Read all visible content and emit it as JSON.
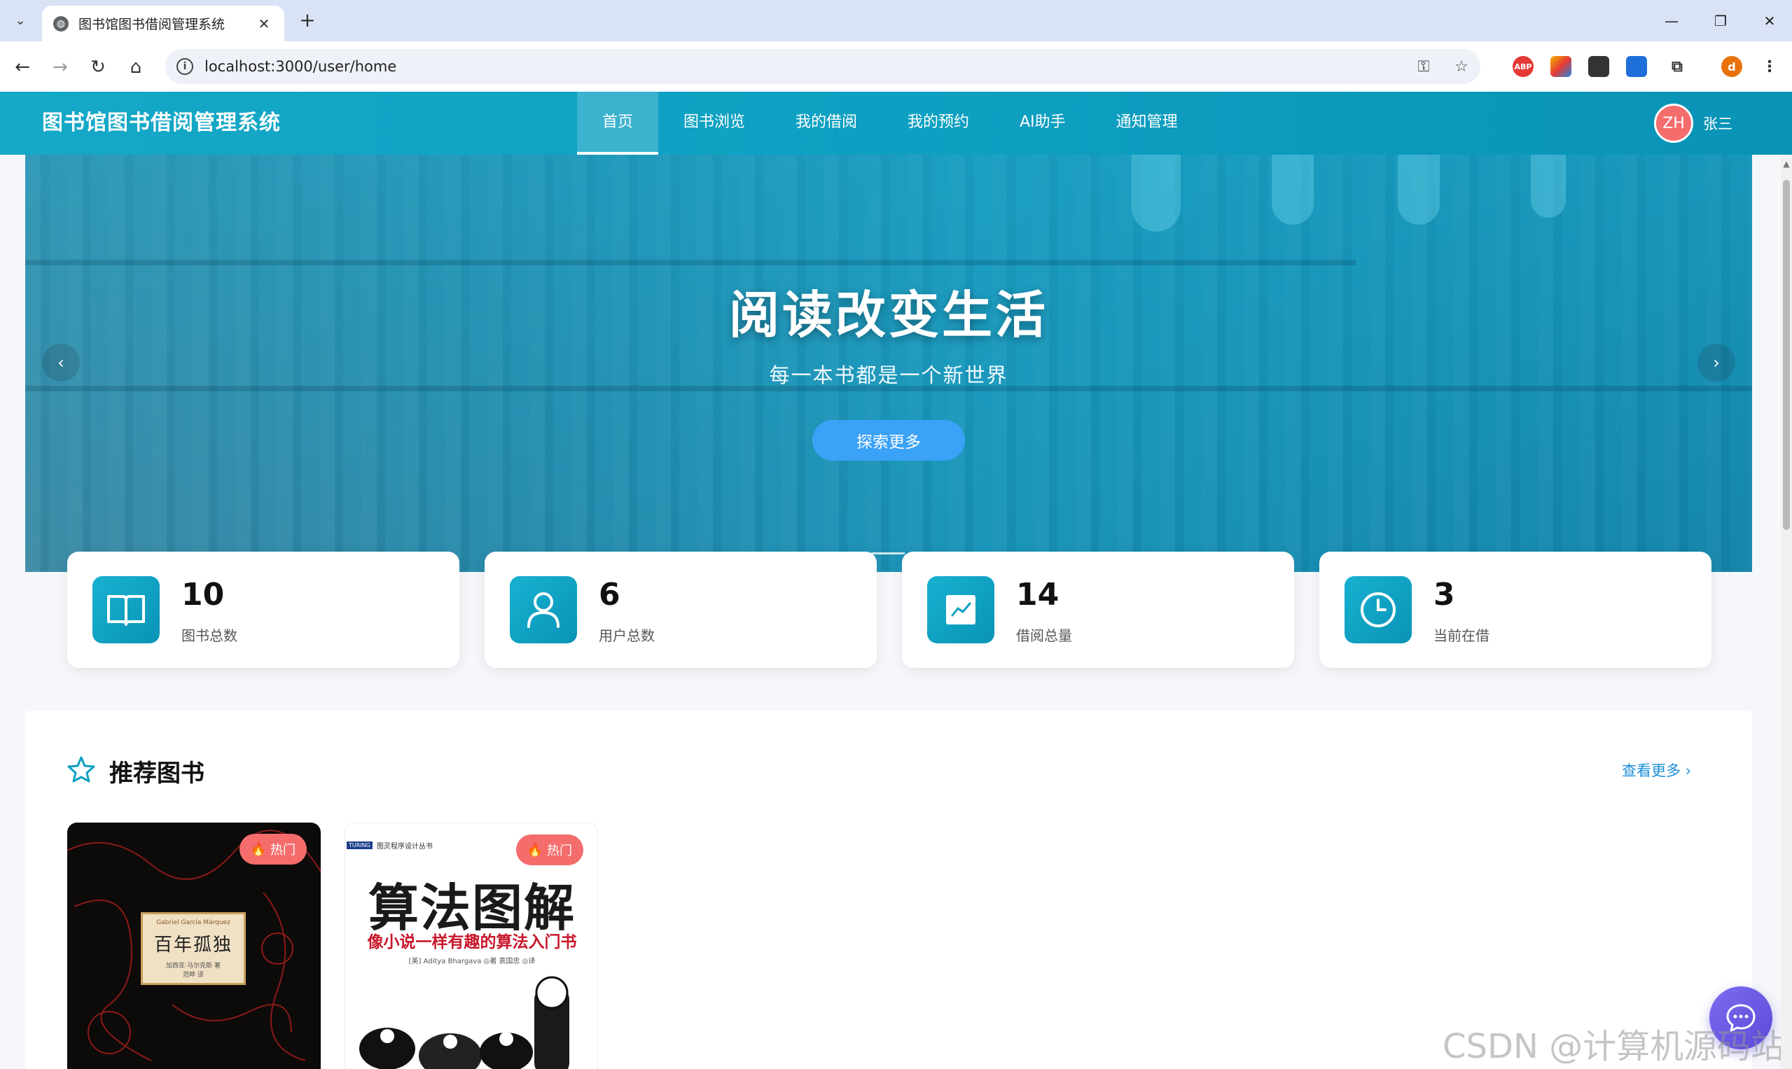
{
  "browser": {
    "tab_title": "图书馆图书借阅管理系统",
    "url": "localhost:3000/user/home",
    "extensions": [
      {
        "name": "ABP",
        "color": "#e53935"
      },
      {
        "name": "",
        "color": "#f4b400"
      },
      {
        "name": "",
        "color": "#333333"
      },
      {
        "name": "",
        "color": "#1e6fd9"
      }
    ],
    "profile_initial": "d"
  },
  "header": {
    "brand": "图书馆图书借阅管理系统",
    "nav": [
      {
        "label": "首页",
        "active": true
      },
      {
        "label": "图书浏览"
      },
      {
        "label": "我的借阅"
      },
      {
        "label": "我的预约"
      },
      {
        "label": "AI助手"
      },
      {
        "label": "通知管理"
      }
    ],
    "user": {
      "avatar_text": "ZH",
      "name": "张三"
    }
  },
  "banner": {
    "title": "阅读改变生活",
    "subtitle": "每一本书都是一个新世界",
    "button": "探索更多",
    "prev_icon": "chevron-left-icon",
    "next_icon": "chevron-right-icon"
  },
  "stats": [
    {
      "value": "10",
      "label": "图书总数",
      "icon": "book-icon"
    },
    {
      "value": "6",
      "label": "用户总数",
      "icon": "user-icon"
    },
    {
      "value": "14",
      "label": "借阅总量",
      "icon": "trend-chart-icon"
    },
    {
      "value": "3",
      "label": "当前在借",
      "icon": "clock-icon"
    }
  ],
  "recommended": {
    "title": "推荐图书",
    "more": "查看更多",
    "hot_label": "热门",
    "books": [
      {
        "cover_en": "Gabriel García Márquez",
        "cover_title": "百年孤独",
        "cover_author": "加西亚·马尔克斯 著",
        "cover_translator": "范晔 译"
      },
      {
        "series_badge": "TURING",
        "series": "图灵程序设计丛书",
        "cover_title": "算法图解",
        "cover_subtitle": "像小说一样有趣的算法入门书",
        "cover_author": "[美] Aditya Bhargava ◎著 袁国忠 ◎译"
      }
    ]
  },
  "watermark": "CSDN @计算机源码站",
  "colors": {
    "primary": "#0ea0c2",
    "accent": "#3aa2f7",
    "hot": "#f56c6c",
    "link": "#1b8fd9"
  }
}
